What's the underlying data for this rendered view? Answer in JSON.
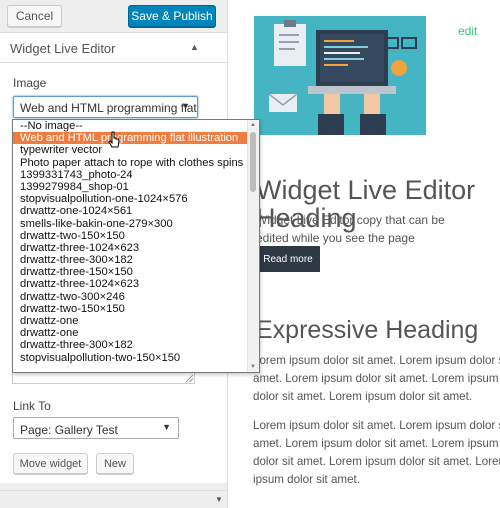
{
  "toolbar": {
    "cancel_label": "Cancel",
    "publish_label": "Save & Publish"
  },
  "section": {
    "title": "Widget Live Editor"
  },
  "image_field": {
    "label": "Image",
    "selected": "Web and HTML programming flat illustration",
    "options": [
      "--No image--",
      "Web and HTML programming flat illustration",
      "typewriter vector",
      "Photo paper attach to rope with clothes spins",
      "1399331743_photo-24",
      "1399279984_shop-01",
      "stopvisualpollution-one-1024×576",
      "drwattz-one-1024×561",
      "smells-like-bakin-one-279×300",
      "drwattz-two-150×150",
      "drwattz-three-1024×623",
      "drwattz-three-300×182",
      "drwattz-three-150×150",
      "drwattz-three-1024×623",
      "drwattz-two-300×246",
      "drwattz-two-150×150",
      "drwattz-one",
      "drwattz-one",
      "drwattz-three-300×182",
      "stopvisualpollution-two-150×150"
    ],
    "selected_index": 1
  },
  "link_field": {
    "label": "Link To",
    "value": "Page: Gallery Test"
  },
  "actions": {
    "move_label": "Move widget",
    "new_label": "New"
  },
  "preview": {
    "edit_label": "edit",
    "title": "Widget Live Editor Heading",
    "copy": "Widget Live Editor copy that can be edited while you see the page",
    "button_label": "Read more",
    "heading": "Expressive Heading",
    "para1": "Lorem ipsum dolor sit amet. Lorem ipsum dolor sit amet. Lorem ipsum dolor sit amet. Lorem ipsum dolor sit amet. Lorem ipsum dolor sit amet.",
    "para2": "Lorem ipsum dolor sit amet. Lorem ipsum dolor sit amet. Lorem ipsum dolor sit amet. Lorem ipsum dolor sit amet. Lorem ipsum dolor sit amet. Lorem ipsum dolor sit amet."
  },
  "colors": {
    "primary": "#0085ba",
    "selected_option": "#f07d40",
    "edit_link": "#2ecc71",
    "read_more_bg": "#2f3945"
  }
}
